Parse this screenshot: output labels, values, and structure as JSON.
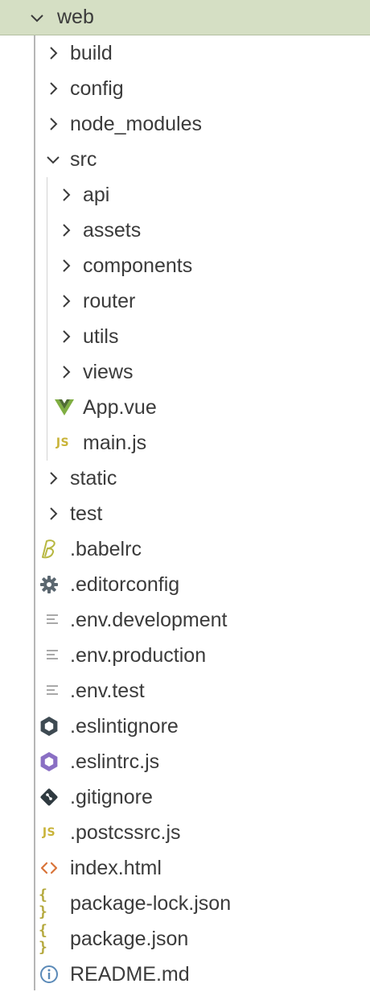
{
  "explorer": {
    "root": {
      "label": "web",
      "expanded": true
    },
    "level1_folders_top": [
      {
        "label": "build",
        "expanded": false
      },
      {
        "label": "config",
        "expanded": false
      },
      {
        "label": "node_modules",
        "expanded": false
      },
      {
        "label": "src",
        "expanded": true
      }
    ],
    "src_children": [
      {
        "label": "api",
        "expanded": false
      },
      {
        "label": "assets",
        "expanded": false
      },
      {
        "label": "components",
        "expanded": false
      },
      {
        "label": "router",
        "expanded": false
      },
      {
        "label": "utils",
        "expanded": false
      },
      {
        "label": "views",
        "expanded": false
      }
    ],
    "src_files": [
      {
        "label": "App.vue",
        "icon": "vue-icon"
      },
      {
        "label": "main.js",
        "icon": "js-icon",
        "icon_text": "JS"
      }
    ],
    "level1_folders_bottom": [
      {
        "label": "static",
        "expanded": false
      },
      {
        "label": "test",
        "expanded": false
      }
    ],
    "root_files": [
      {
        "label": ".babelrc",
        "icon": "babel-icon"
      },
      {
        "label": ".editorconfig",
        "icon": "gear-icon"
      },
      {
        "label": ".env.development",
        "icon": "text-file-icon"
      },
      {
        "label": ".env.production",
        "icon": "text-file-icon"
      },
      {
        "label": ".env.test",
        "icon": "text-file-icon"
      },
      {
        "label": ".eslintignore",
        "icon": "eslint-ignore-icon"
      },
      {
        "label": ".eslintrc.js",
        "icon": "eslint-icon"
      },
      {
        "label": ".gitignore",
        "icon": "git-icon"
      },
      {
        "label": ".postcssrc.js",
        "icon": "js-icon",
        "icon_text": "JS"
      },
      {
        "label": "index.html",
        "icon": "html-icon"
      },
      {
        "label": "package-lock.json",
        "icon": "json-icon",
        "icon_text": "{ }"
      },
      {
        "label": "package.json",
        "icon": "json-icon",
        "icon_text": "{ }"
      },
      {
        "label": "README.md",
        "icon": "info-icon"
      }
    ]
  },
  "colors": {
    "selected_row": "#d5dfc4",
    "text": "#3b3b3b",
    "vue_green": "#7fae42",
    "js_yellow": "#c9b43a",
    "eslint_purple": "#8a6fc4",
    "html_orange": "#d9743a",
    "info_blue": "#5b8ab8"
  }
}
